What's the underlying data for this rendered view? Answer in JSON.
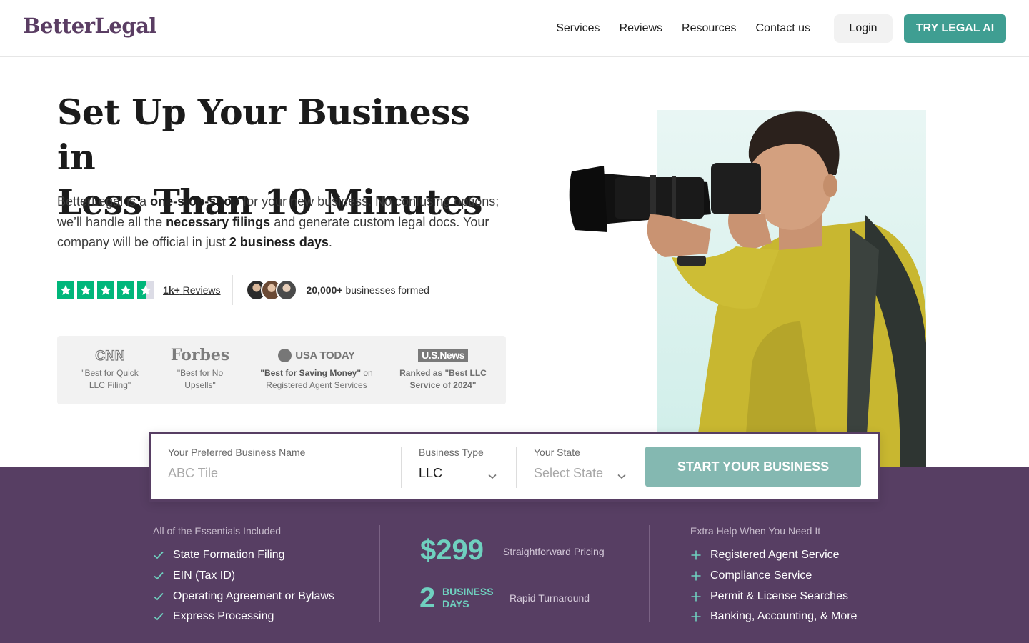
{
  "brand": {
    "logo": "BetterLegal"
  },
  "nav": {
    "links": [
      "Services",
      "Reviews",
      "Resources",
      "Contact us"
    ],
    "login": "Login",
    "cta": "TRY LEGAL AI"
  },
  "hero": {
    "title_line1": "Set Up Your Business in",
    "title_line2": "Less Than 10 Minutes",
    "desc": {
      "p1": "BetterLegal is a ",
      "b1": "one-stop-shop",
      "p2": " for your new business. No confusing options; we’ll handle all the ",
      "b2": "necessary filings",
      "p3": " and generate custom legal docs. Your company will be official in just ",
      "b3": "2 business days",
      "p4": "."
    },
    "reviews_count": "1k+",
    "reviews_word": "Reviews",
    "businesses_count": "20,000+",
    "businesses_text": "businesses formed",
    "rating_stars": 4.5
  },
  "press": [
    {
      "logo": "CNN",
      "quote": "\"Best for Quick LLC Filing\""
    },
    {
      "logo": "Forbes",
      "quote": "\"Best for No Upsells\""
    },
    {
      "logo": "USA TODAY",
      "quote_bold": "\"Best for Saving Money\"",
      "quote_rest": " on Registered Agent Services"
    },
    {
      "logo": "U.S.News",
      "quote": "Ranked as \"Best LLC Service of 2024\""
    }
  ],
  "form": {
    "name_label": "Your Preferred Business Name",
    "name_placeholder": "ABC Tile",
    "type_label": "Business Type",
    "type_value": "LLC",
    "state_label": "Your State",
    "state_placeholder": "Select State",
    "submit": "START YOUR BUSINESS"
  },
  "essentials": {
    "title": "All of the Essentials Included",
    "items": [
      "State Formation Filing",
      "EIN (Tax ID)",
      "Operating Agreement or Bylaws",
      "Express Processing"
    ]
  },
  "pricing": {
    "price": "$299",
    "price_label": "Straightforward Pricing",
    "days_num": "2",
    "days_line1": "BUSINESS",
    "days_line2": "DAYS",
    "days_label": "Rapid Turnaround"
  },
  "extra": {
    "title": "Extra Help When You Need It",
    "items": [
      "Registered Agent Service",
      "Compliance Service",
      "Permit & License Searches",
      "Banking, Accounting, & More"
    ]
  },
  "colors": {
    "brand_purple": "#573e63",
    "teal": "#3f9e92",
    "accent_teal": "#6fd0bf",
    "trustpilot": "#00b67a"
  }
}
